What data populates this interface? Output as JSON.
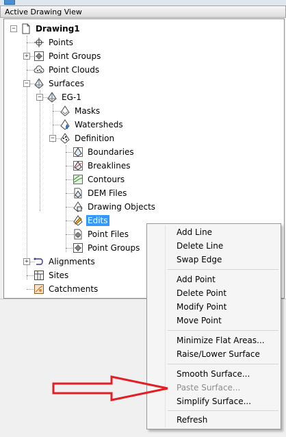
{
  "header": {
    "title": "Active Drawing View"
  },
  "tree": {
    "drawing": "Drawing1",
    "points": "Points",
    "point_groups": "Point Groups",
    "point_clouds": "Point Clouds",
    "surfaces": "Surfaces",
    "eg1": "EG-1",
    "masks": "Masks",
    "watersheds": "Watersheds",
    "definition": "Definition",
    "boundaries": "Boundaries",
    "breaklines": "Breaklines",
    "contours": "Contours",
    "dem_files": "DEM Files",
    "drawing_objects": "Drawing Objects",
    "edits": "Edits",
    "point_files": "Point Files",
    "def_point_groups": "Point Groups",
    "alignments": "Alignments",
    "sites": "Sites",
    "catchments": "Catchments",
    "selected_item": "Edits"
  },
  "context_menu": {
    "add_line": "Add Line",
    "delete_line": "Delete Line",
    "swap_edge": "Swap Edge",
    "add_point": "Add Point",
    "delete_point": "Delete Point",
    "modify_point": "Modify Point",
    "move_point": "Move Point",
    "minimize_flat": "Minimize Flat Areas...",
    "raise_lower": "Raise/Lower Surface",
    "smooth": "Smooth Surface...",
    "paste": "Paste Surface...",
    "simplify": "Simplify Surface...",
    "refresh": "Refresh"
  },
  "disabled_items": [
    "Paste Surface..."
  ],
  "colors": {
    "selection": "#3399ff",
    "annotation_arrow": "#e31e24"
  },
  "icons": {
    "drawing": "document-icon",
    "points": "point-icon",
    "point_groups": "point-group-icon",
    "point_clouds": "point-cloud-icon",
    "surfaces": "surface-icon",
    "alignments": "alignment-icon",
    "sites": "site-icon",
    "catchments": "catchment-icon"
  }
}
